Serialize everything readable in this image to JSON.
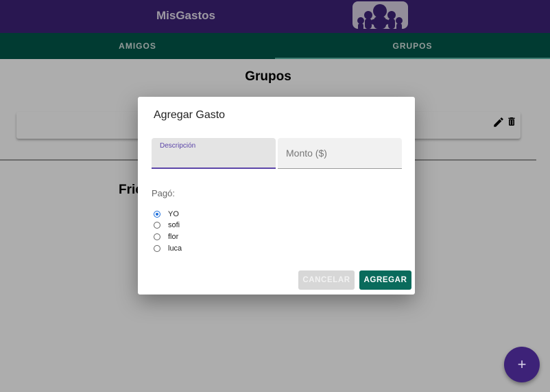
{
  "app": {
    "title": "MisGastos",
    "logo": "group-people-logo"
  },
  "tabs": [
    {
      "label": "AMIGOS",
      "active": false
    },
    {
      "label": "GRUPOS",
      "active": true
    }
  ],
  "main": {
    "heading": "Grupos",
    "friends_heading": "Frie",
    "card_icons": [
      "edit-icon",
      "trash-icon"
    ]
  },
  "dialog": {
    "title": "Agregar Gasto",
    "descripcion": {
      "label": "Descripción",
      "value": ""
    },
    "monto": {
      "placeholder": "Monto ($)",
      "value": ""
    },
    "pago_label": "Pagó:",
    "options": [
      {
        "label": "YO",
        "checked": true
      },
      {
        "label": "sofi",
        "checked": false
      },
      {
        "label": "flor",
        "checked": false
      },
      {
        "label": "luca",
        "checked": false
      }
    ],
    "cancel_label": "CANCELAR",
    "submit_label": "AGREGAR"
  },
  "fab": {
    "label": "+",
    "icon": "plus-icon"
  },
  "colors": {
    "app_bar": "#3d2278",
    "tabs_bar": "#02574b",
    "accent": "#5b44a8",
    "submit": "#0a6b5c",
    "radio": "#1e6fdc"
  }
}
